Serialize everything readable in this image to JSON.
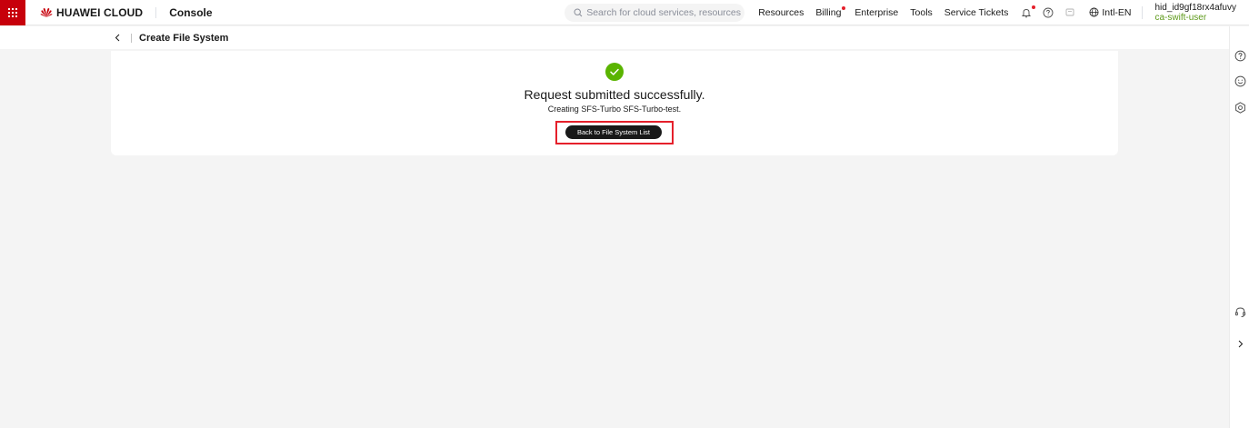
{
  "topbar": {
    "brand": "HUAWEI CLOUD",
    "console": "Console",
    "search_placeholder": "Search for cloud services, resources (IP ad...",
    "nav": {
      "resources": "Resources",
      "billing": "Billing",
      "enterprise": "Enterprise",
      "tools": "Tools",
      "service_tickets": "Service Tickets"
    },
    "language": "Intl-EN",
    "user_id": "hid_id9gf18rx4afuvy",
    "user_name": "ca-swift-user"
  },
  "header": {
    "title": "Create File System"
  },
  "result": {
    "title": "Request submitted successfully.",
    "description": "Creating SFS-Turbo SFS-Turbo-test.",
    "back_button": "Back to File System List"
  },
  "colors": {
    "brand_red": "#c7000b",
    "success_green": "#5ab400",
    "highlight_red": "#e5202b",
    "user_green": "#5e9a1b"
  },
  "icons": {
    "menu": "grid-icon",
    "logo": "huawei-logo-icon",
    "search": "search-icon",
    "notifications": "bell-icon",
    "help": "help-icon",
    "messages": "message-icon",
    "language": "globe-icon",
    "back": "chevron-left-icon",
    "success": "check-circle-icon",
    "rail_help": "help-icon",
    "rail_feedback": "smile-icon",
    "rail_settings": "settings-icon",
    "rail_support": "headset-icon",
    "rail_expand": "chevron-right-icon"
  }
}
